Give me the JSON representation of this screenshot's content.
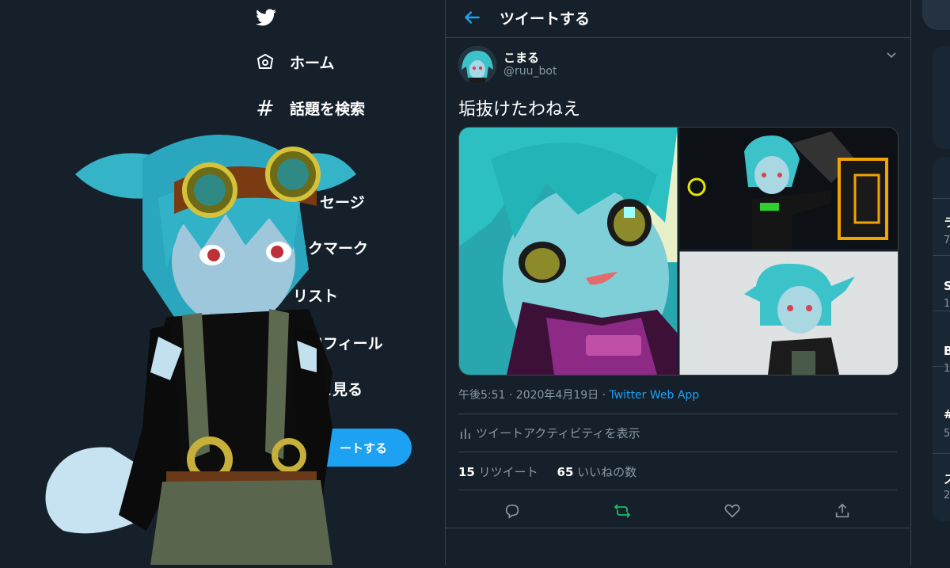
{
  "nav": {
    "items": [
      {
        "label": "ホーム",
        "icon": "home-icon"
      },
      {
        "label": "話題を検索",
        "icon": "hashtag-icon"
      },
      {
        "label": "セージ",
        "icon": "mail-icon"
      },
      {
        "label": "ックマーク",
        "icon": "bookmark-icon"
      },
      {
        "label": "リスト",
        "icon": "list-icon"
      },
      {
        "label": "プロフィール",
        "icon": "profile-icon"
      },
      {
        "label": "っと見る",
        "icon": "more-icon"
      }
    ],
    "tweet_button": "ートする"
  },
  "header": {
    "title": "ツイートする"
  },
  "tweet": {
    "display_name": "こまる",
    "handle": "@ruu_bot",
    "text": "垢抜けたわねえ",
    "time": "午後5:51 · 2020年4月19日 · ",
    "app": "Twitter Web App",
    "activity": "ツイートアクティビティを表示",
    "retweets": "15",
    "retweets_label": "リツイート",
    "likes": "65",
    "likes_label": "いいねの数"
  },
  "right": {
    "letters": [
      "ラ",
      "S",
      "B",
      "#",
      "ス"
    ],
    "subs": [
      "7",
      "1",
      "1",
      "5",
      "2"
    ]
  },
  "colors": {
    "accent": "#1da1f2",
    "bg": "#15202b",
    "border": "#38444d",
    "muted": "#8899a6",
    "retweet": "#17bf63"
  }
}
